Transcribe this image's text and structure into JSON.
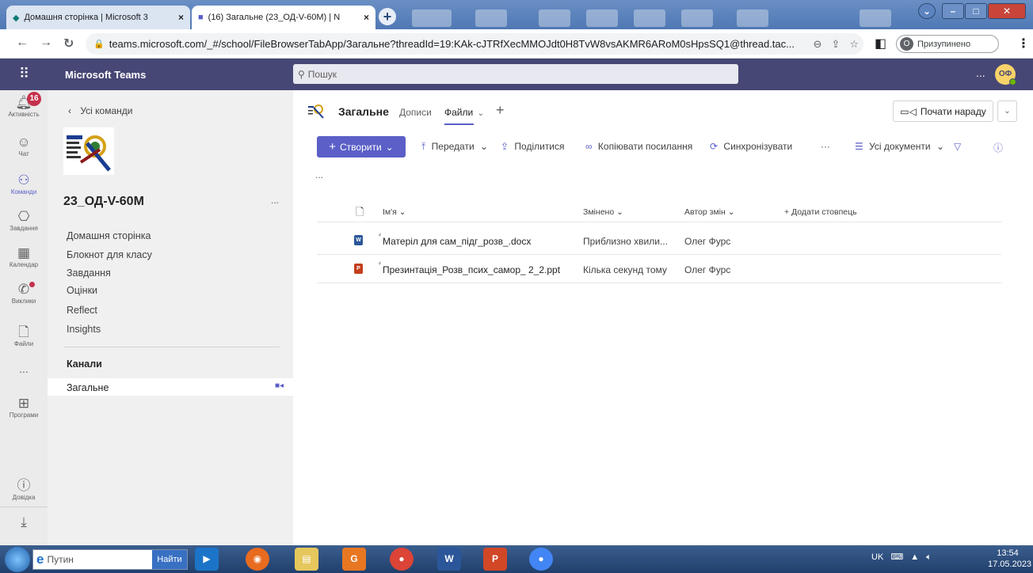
{
  "browser": {
    "tabs": [
      {
        "title": "Домашня сторінка | Microsoft 3",
        "close": "×"
      },
      {
        "title": "(16) Загальне (23_ОД-V-60M) | N",
        "close": "×"
      }
    ],
    "new_tab": "+",
    "url": "teams.microsoft.com/_#/school/FileBrowserTabApp/Загальне?threadId=19:KAk-cJTRfXecMMOJdt0H8TvW8vsAKMR6ARoM0sHpsSQ1@thread.tac...",
    "profile_initial": "О",
    "profile_status": "Призупинено"
  },
  "teams": {
    "app_name": "Microsoft Teams",
    "search_placeholder": "Пошук",
    "more": "...",
    "user_initials": "ОФ"
  },
  "rail": {
    "items": [
      {
        "label": "Активність",
        "badge": "16"
      },
      {
        "label": "Чат"
      },
      {
        "label": "Команди"
      },
      {
        "label": "Завдання"
      },
      {
        "label": "Календар"
      },
      {
        "label": "Виклики"
      },
      {
        "label": "Файли"
      },
      {
        "label": "..."
      },
      {
        "label": "Програми"
      },
      {
        "label": "Довідка"
      }
    ]
  },
  "team_panel": {
    "back_label": "Усі команди",
    "team_name": "23_ОД-V-60М",
    "more": "...",
    "links": [
      "Домашня сторінка",
      "Блокнот для класу",
      "Завдання",
      "Оцінки",
      "Reflect",
      "Insights"
    ],
    "channels_header": "Канали",
    "channel": "Загальне"
  },
  "main": {
    "channel_name": "Загальне",
    "tabs": [
      "Дописи",
      "Файли"
    ],
    "meet_button": "Почати нараду",
    "toolbar": {
      "create": "Створити",
      "upload": "Передати",
      "share": "Поділитися",
      "copy_link": "Копіювати посилання",
      "sync": "Синхронізувати",
      "more": "···",
      "view": "Усі документи"
    },
    "breadcrumb_more": "...",
    "columns": {
      "name": "Ім'я",
      "modified": "Змінено",
      "author": "Автор змін",
      "add_column": "Додати стовпець"
    },
    "files": [
      {
        "name": "Матеріл для сам_підг_розв_.docx",
        "modified": "Приблизно хвили...",
        "author": "Олег Фурс",
        "type": "docx"
      },
      {
        "name": "Презинтація_Розв_псих_самор_ 2_2.ppt",
        "modified": "Кілька секунд тому",
        "author": "Олег Фурс",
        "type": "ppt"
      }
    ]
  },
  "taskbar": {
    "search_text": "Путин",
    "search_button": "Найти",
    "lang": "UK",
    "time": "13:54",
    "date": "17.05.2023"
  },
  "colors": {
    "teams_purple": "#5b5fc7",
    "header": "#464775",
    "word_blue": "#2b579a",
    "ppt_red": "#c43e1c"
  }
}
